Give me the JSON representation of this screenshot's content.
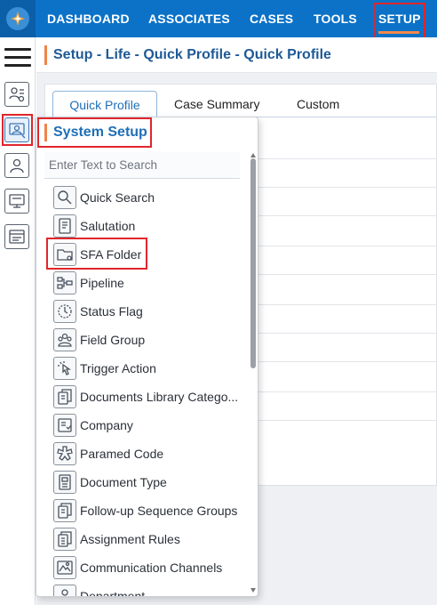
{
  "nav": {
    "items": [
      "DASHBOARD",
      "ASSOCIATES",
      "CASES",
      "TOOLS",
      "SETUP"
    ],
    "active": "SETUP"
  },
  "breadcrumb": "Setup - Life - Quick Profile - Quick Profile",
  "tabs": [
    "Quick Profile",
    "Case Summary",
    "Custom"
  ],
  "popup": {
    "title": "System Setup",
    "search_placeholder": "Enter Text to Search",
    "items": [
      {
        "label": "Quick Search",
        "icon": "search-icon"
      },
      {
        "label": "Salutation",
        "icon": "document-icon"
      },
      {
        "label": "SFA Folder",
        "icon": "folder-icon"
      },
      {
        "label": "Pipeline",
        "icon": "pipeline-icon"
      },
      {
        "label": "Status Flag",
        "icon": "status-flag-icon"
      },
      {
        "label": "Field Group",
        "icon": "people-group-icon"
      },
      {
        "label": "Trigger Action",
        "icon": "pointer-click-icon"
      },
      {
        "label": "Documents Library Catego...",
        "icon": "documents-library-icon"
      },
      {
        "label": "Company",
        "icon": "company-icon"
      },
      {
        "label": "Paramed Code",
        "icon": "medical-cross-icon"
      },
      {
        "label": "Document Type",
        "icon": "document-type-icon"
      },
      {
        "label": "Follow-up Sequence Groups",
        "icon": "sequence-icon"
      },
      {
        "label": "Assignment Rules",
        "icon": "rules-icon"
      },
      {
        "label": "Communication Channels",
        "icon": "communication-icon"
      },
      {
        "label": "Department",
        "icon": "department-icon"
      }
    ]
  },
  "colors": {
    "nav_bg": "#0b72c7",
    "accent": "#f0834a",
    "highlight": "#e0262c",
    "title_blue": "#1f6fb8"
  }
}
